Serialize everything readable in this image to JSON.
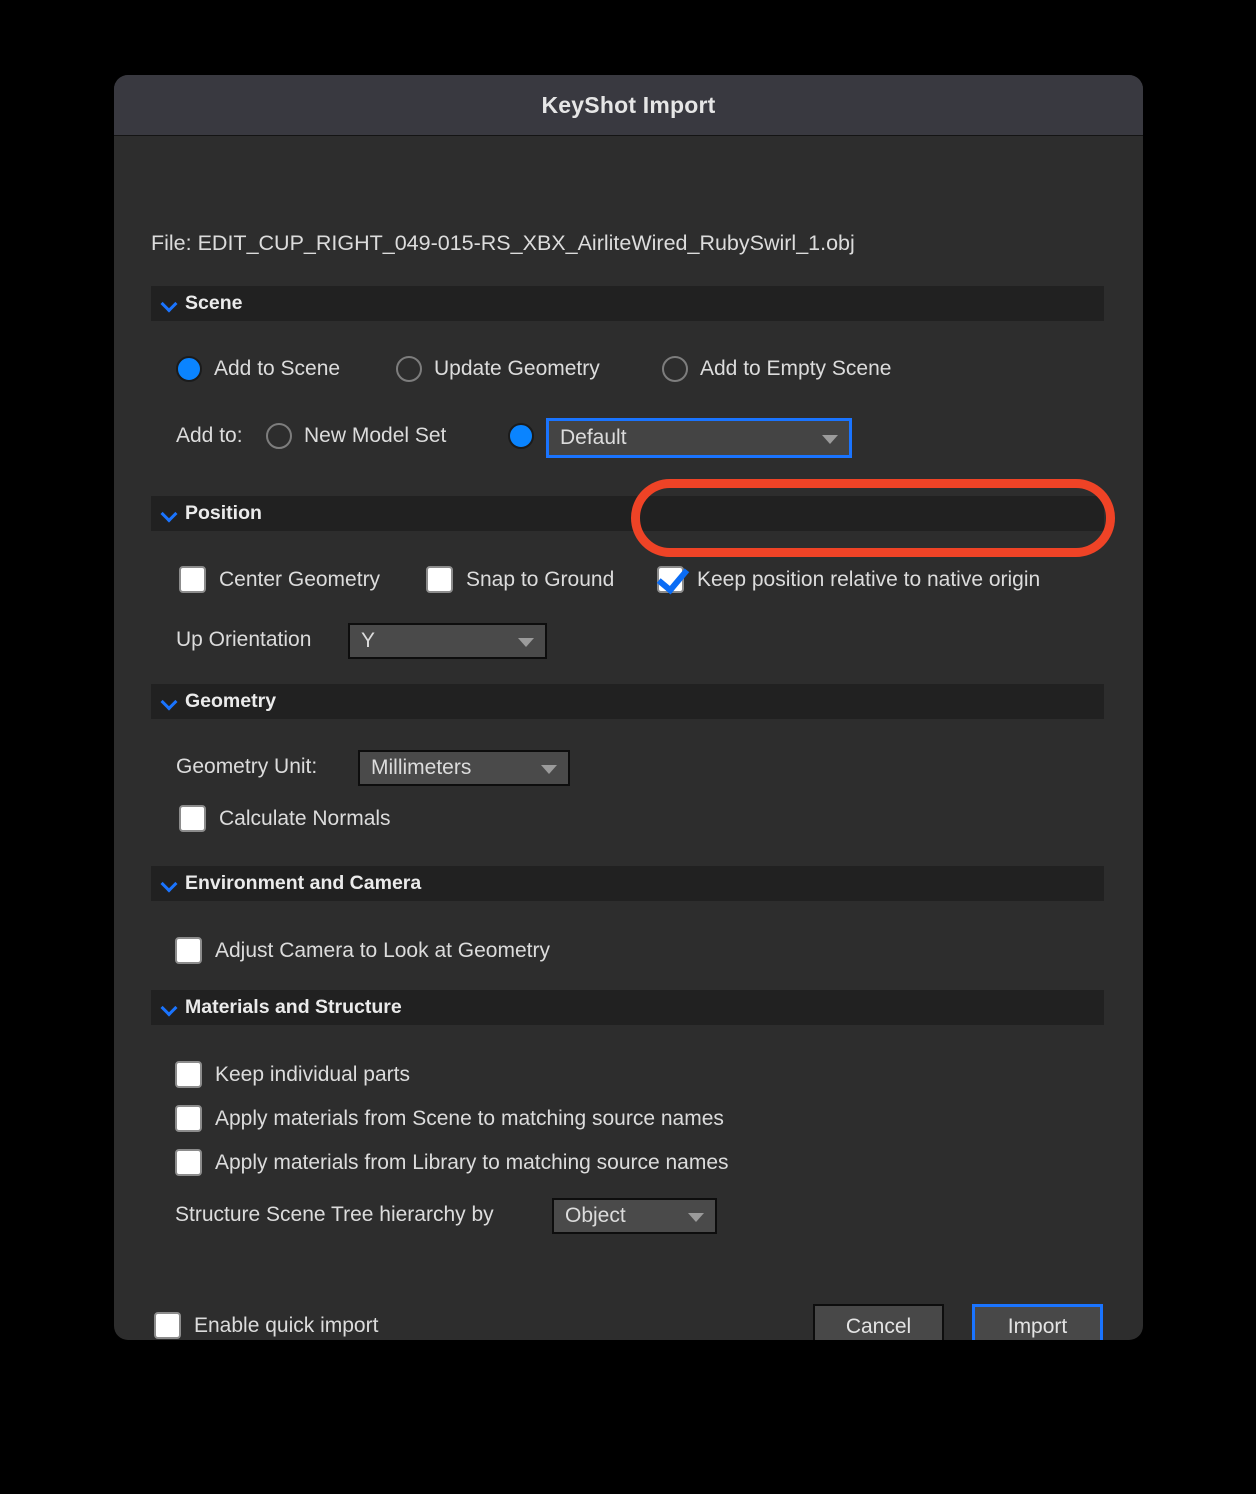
{
  "window": {
    "title": "KeyShot Import",
    "file_line": "File: EDIT_CUP_RIGHT_049-015-RS_XBX_AirliteWired_RubySwirl_1.obj"
  },
  "colors": {
    "accent_blue": "#0a84ff",
    "focus_blue": "#1a74ff",
    "annotation_red": "#ef4326",
    "dialog_bg": "#2d2d2d",
    "titlebar_bg": "#393940",
    "section_header_bg": "#212121"
  },
  "sections": {
    "scene": {
      "header": "Scene",
      "chevron": "chevron-down-icon",
      "mode_options": [
        {
          "label": "Add to Scene",
          "selected": true
        },
        {
          "label": "Update Geometry",
          "selected": false
        },
        {
          "label": "Add to Empty Scene",
          "selected": false
        }
      ],
      "add_to_label": "Add to:",
      "new_model_set": {
        "label": "New Model Set",
        "selected": false
      },
      "model_set_radio_selected": true,
      "model_set_dropdown": {
        "value": "Default",
        "focused": true
      }
    },
    "position": {
      "header": "Position",
      "chevron": "chevron-down-icon",
      "checkboxes": [
        {
          "label": "Center Geometry",
          "checked": false
        },
        {
          "label": "Snap to Ground",
          "checked": false
        },
        {
          "label": "Keep position relative to native origin",
          "checked": true,
          "highlighted": true
        }
      ],
      "up_orientation_label": "Up Orientation",
      "up_orientation_value": "Y"
    },
    "geometry": {
      "header": "Geometry",
      "chevron": "chevron-down-icon",
      "unit_label": "Geometry Unit:",
      "unit_value": "Millimeters",
      "calculate_normals": {
        "label": "Calculate Normals",
        "checked": false
      }
    },
    "environment": {
      "header": "Environment and Camera",
      "chevron": "chevron-down-icon",
      "adjust_camera": {
        "label": "Adjust Camera to Look at Geometry",
        "checked": false
      }
    },
    "materials": {
      "header": "Materials and Structure",
      "chevron": "chevron-down-icon",
      "checkboxes": [
        {
          "label": "Keep individual parts",
          "checked": false
        },
        {
          "label": "Apply materials from Scene to matching source names",
          "checked": false
        },
        {
          "label": "Apply materials from Library to matching source names",
          "checked": false
        }
      ],
      "structure_label": "Structure Scene Tree hierarchy by",
      "structure_value": "Object"
    }
  },
  "footer": {
    "quick_import": {
      "label": "Enable quick import",
      "checked": false
    },
    "cancel_label": "Cancel",
    "import_label": "Import"
  }
}
